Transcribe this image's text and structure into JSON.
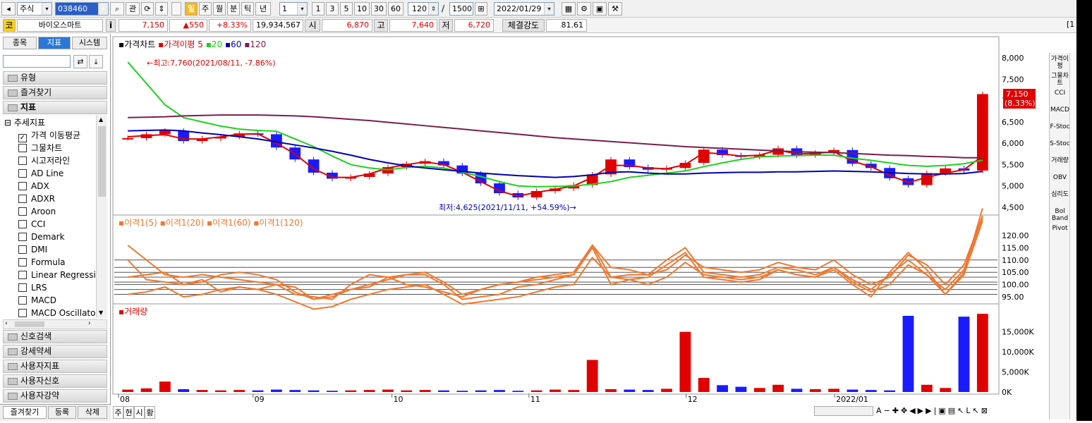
{
  "toolbar": {
    "market": "주식",
    "code": "038460",
    "kwan": "관",
    "periods": [
      "일",
      "주",
      "월",
      "분",
      "틱",
      "년"
    ],
    "interval": "1",
    "nums": [
      "1",
      "3",
      "5",
      "10",
      "30",
      "60"
    ],
    "count": "120",
    "total": "1500",
    "slash": "/",
    "date": "2022/01/29"
  },
  "quote": {
    "code_label": "코",
    "name": "바이오스마트",
    "info": "i",
    "price": "7,150",
    "change": "▲550",
    "change_pct": "+8.33%",
    "volume": "19,934,567",
    "open_label": "시",
    "open": "6,870",
    "high_label": "고",
    "high": "7,640",
    "low_label": "저",
    "low": "6,720",
    "strength_label": "체결강도",
    "strength": "81.61",
    "right_edge": "[1"
  },
  "sidebar": {
    "tabs": [
      "종목",
      "지표",
      "시스템"
    ],
    "groups_top": [
      "유형",
      "즐겨찾기",
      "지표"
    ],
    "tree_root": "추세지표",
    "items": [
      {
        "label": "가격 이동평균",
        "checked": true
      },
      {
        "label": "그물차트",
        "checked": false
      },
      {
        "label": "시고저라인",
        "checked": false
      },
      {
        "label": "AD Line",
        "checked": false
      },
      {
        "label": "ADX",
        "checked": false
      },
      {
        "label": "ADXR",
        "checked": false
      },
      {
        "label": "Aroon",
        "checked": false
      },
      {
        "label": "CCI",
        "checked": false
      },
      {
        "label": "Demark",
        "checked": false
      },
      {
        "label": "DMI",
        "checked": false
      },
      {
        "label": "Formula",
        "checked": false
      },
      {
        "label": "Linear Regression",
        "checked": false
      },
      {
        "label": "LRS",
        "checked": false
      },
      {
        "label": "MACD",
        "checked": false
      },
      {
        "label": "MACD Oscillator",
        "checked": false
      }
    ],
    "groups_bottom": [
      "신호검색",
      "강세약세",
      "사용자지표",
      "사용자신호",
      "사용자강약"
    ],
    "bottom_buttons": [
      "즐겨찾기",
      "등록",
      "삭제"
    ]
  },
  "chart": {
    "price_legend": [
      "가격차트",
      "가격이평",
      "5",
      "20",
      "60",
      "120"
    ],
    "max_note": "←최고:7,760(2021/08/11, -7.86%)",
    "min_note": "최저:4,625(2021/11/11, +54.59%)→",
    "price_ticks": [
      "8,000",
      "7,500",
      "7,000",
      "6,500",
      "6,000",
      "5,500",
      "5,000",
      "4,500"
    ],
    "price_tag": "7,150",
    "price_tag_pct": "(8.33%)",
    "disp_legend": [
      "이격1(5)",
      "이격1(20)",
      "이격1(60)",
      "이격1(120)"
    ],
    "disp_ticks": [
      "120.00",
      "115.00",
      "110.00",
      "105.00",
      "100.00",
      "95.00"
    ],
    "vol_legend": "거래량",
    "vol_ticks": [
      "15,000K",
      "10,000K",
      "5,000K",
      "0K"
    ],
    "x_labels": [
      "08",
      "09",
      "10",
      "11",
      "12",
      "2022/01"
    ],
    "bottom_tabs": [
      "주",
      "현",
      "시",
      "황"
    ]
  },
  "rpanel_items": [
    "가격이평",
    "그물차트",
    "CCI",
    "MACD",
    "F-Stoc",
    "S-Stoc",
    "거래량",
    "OBV",
    "심리도",
    "Bol Band",
    "Pivot"
  ],
  "colors": {
    "up": "#e00000",
    "down": "#1a1aff",
    "ma5": "#e00000",
    "ma20": "#20d020",
    "ma60": "#0000b0",
    "ma120": "#7a1e4a",
    "disp": "#f07830"
  },
  "chart_data": [
    {
      "type": "candlestick",
      "x": [
        "08",
        "09",
        "10",
        "11",
        "12",
        "2022/01"
      ],
      "ylim": [
        4500,
        8000
      ],
      "series": [
        {
          "name": "가격차트",
          "values": [
            6120,
            6210,
            6290,
            6050,
            6110,
            6150,
            6230,
            6210,
            5900,
            5620,
            5310,
            5170,
            5210,
            5290,
            5440,
            5520,
            5580,
            5480,
            5290,
            5060,
            4830,
            4730,
            4880,
            4940,
            5020,
            5270,
            5620,
            5440,
            5380,
            5420,
            5540,
            5850,
            5720,
            5680,
            5730,
            5880,
            5720,
            5780,
            5840,
            5520,
            5420,
            5180,
            5020,
            5300,
            5410,
            5360,
            7150
          ]
        },
        {
          "name": "5",
          "values": [
            6150,
            6180,
            6200,
            6100,
            6100,
            6150,
            6210,
            6220,
            6000,
            5750,
            5400,
            5200,
            5200,
            5280,
            5420,
            5500,
            5560,
            5500,
            5320,
            5100,
            4880,
            4760,
            4850,
            4920,
            5000,
            5200,
            5480,
            5480,
            5420,
            5400,
            5500,
            5780,
            5750,
            5700,
            5720,
            5840,
            5750,
            5760,
            5800,
            5580,
            5450,
            5250,
            5080,
            5200,
            5300,
            5380,
            5700
          ]
        },
        {
          "name": "20",
          "values": [
            7900,
            7400,
            6900,
            6600,
            6500,
            6400,
            6330,
            6300,
            6280,
            6100,
            5920,
            5700,
            5500,
            5420,
            5380,
            5430,
            5460,
            5420,
            5320,
            5220,
            5100,
            5000,
            4980,
            4990,
            5000,
            5040,
            5100,
            5200,
            5250,
            5300,
            5350,
            5450,
            5540,
            5620,
            5680,
            5700,
            5710,
            5720,
            5720,
            5650,
            5600,
            5540,
            5480,
            5460,
            5480,
            5520,
            5600
          ]
        },
        {
          "name": "60",
          "values": [
            6290,
            6300,
            6310,
            6290,
            6240,
            6200,
            6150,
            6100,
            6030,
            5960,
            5890,
            5810,
            5720,
            5620,
            5540,
            5470,
            5420,
            5380,
            5340,
            5300,
            5270,
            5240,
            5220,
            5200,
            5220,
            5260,
            5320,
            5330,
            5300,
            5280,
            5280,
            5300,
            5310,
            5320,
            5320,
            5330,
            5330,
            5340,
            5350,
            5340,
            5330,
            5310,
            5290,
            5280,
            5280,
            5290,
            5340
          ]
        },
        {
          "name": "120",
          "values": [
            6600,
            6610,
            6620,
            6640,
            6650,
            6660,
            6660,
            6660,
            6650,
            6640,
            6620,
            6590,
            6560,
            6530,
            6490,
            6450,
            6410,
            6370,
            6330,
            6290,
            6250,
            6210,
            6170,
            6130,
            6100,
            6070,
            6040,
            6010,
            5980,
            5950,
            5920,
            5900,
            5880,
            5860,
            5840,
            5820,
            5800,
            5790,
            5780,
            5760,
            5740,
            5720,
            5710,
            5690,
            5680,
            5660,
            5660
          ]
        }
      ]
    },
    {
      "type": "line",
      "x": [
        "08",
        "09",
        "10",
        "11",
        "12",
        "2022/01"
      ],
      "ylim": [
        93,
        124
      ],
      "series": [
        {
          "name": "이격1(5)",
          "values": [
            110,
            102,
            101,
            100,
            102,
            97,
            99,
            98,
            100,
            96,
            95,
            94,
            100,
            104,
            103,
            100,
            99,
            97,
            95,
            98,
            100,
            101,
            102,
            103,
            104,
            115,
            100,
            102,
            103,
            108,
            113,
            103,
            102,
            101,
            102,
            106,
            104,
            103,
            106,
            100,
            95,
            105,
            113,
            106,
            96,
            104,
            126
          ]
        },
        {
          "name": "이격1(20)",
          "values": [
            116,
            110,
            104,
            103,
            104,
            103,
            102,
            101,
            100,
            99,
            94,
            96,
            98,
            100,
            102,
            104,
            105,
            101,
            96,
            98,
            100,
            101,
            103,
            104,
            105,
            116,
            103,
            104,
            104,
            110,
            115,
            105,
            104,
            103,
            104,
            107,
            106,
            104,
            107,
            102,
            98,
            104,
            110,
            104,
            98,
            106,
            127
          ]
        },
        {
          "name": "이격1(60)",
          "values": [
            103,
            104,
            105,
            100,
            101,
            104,
            105,
            104,
            102,
            97,
            94,
            95,
            98,
            99,
            103,
            104,
            104,
            100,
            94,
            95,
            96,
            99,
            100,
            102,
            104,
            116,
            107,
            106,
            104,
            106,
            112,
            107,
            106,
            105,
            106,
            109,
            107,
            106,
            110,
            104,
            100,
            103,
            112,
            108,
            100,
            108,
            128
          ]
        },
        {
          "name": "이격1(120)",
          "values": [
            96,
            97,
            99,
            95,
            96,
            98,
            99,
            98,
            96,
            93,
            90,
            91,
            94,
            96,
            98,
            99,
            100,
            96,
            92,
            93,
            94,
            95,
            97,
            99,
            100,
            111,
            103,
            102,
            100,
            103,
            109,
            104,
            103,
            102,
            103,
            106,
            104,
            103,
            107,
            101,
            97,
            100,
            108,
            104,
            96,
            105,
            131
          ]
        }
      ]
    },
    {
      "type": "bar",
      "x": [
        "08",
        "09",
        "10",
        "11",
        "12",
        "2022/01"
      ],
      "ylim": [
        0,
        19000
      ],
      "series": [
        {
          "name": "거래량",
          "values": [
            600,
            900,
            2600,
            700,
            500,
            400,
            500,
            400,
            600,
            500,
            400,
            300,
            400,
            500,
            600,
            400,
            500,
            400,
            300,
            400,
            500,
            300,
            400,
            600,
            500,
            8000,
            700,
            600,
            500,
            800,
            15000,
            3500,
            1700,
            1300,
            1000,
            1800,
            800,
            700,
            800,
            600,
            500,
            400,
            19000,
            1800,
            1000,
            18800,
            19500
          ]
        }
      ]
    }
  ]
}
